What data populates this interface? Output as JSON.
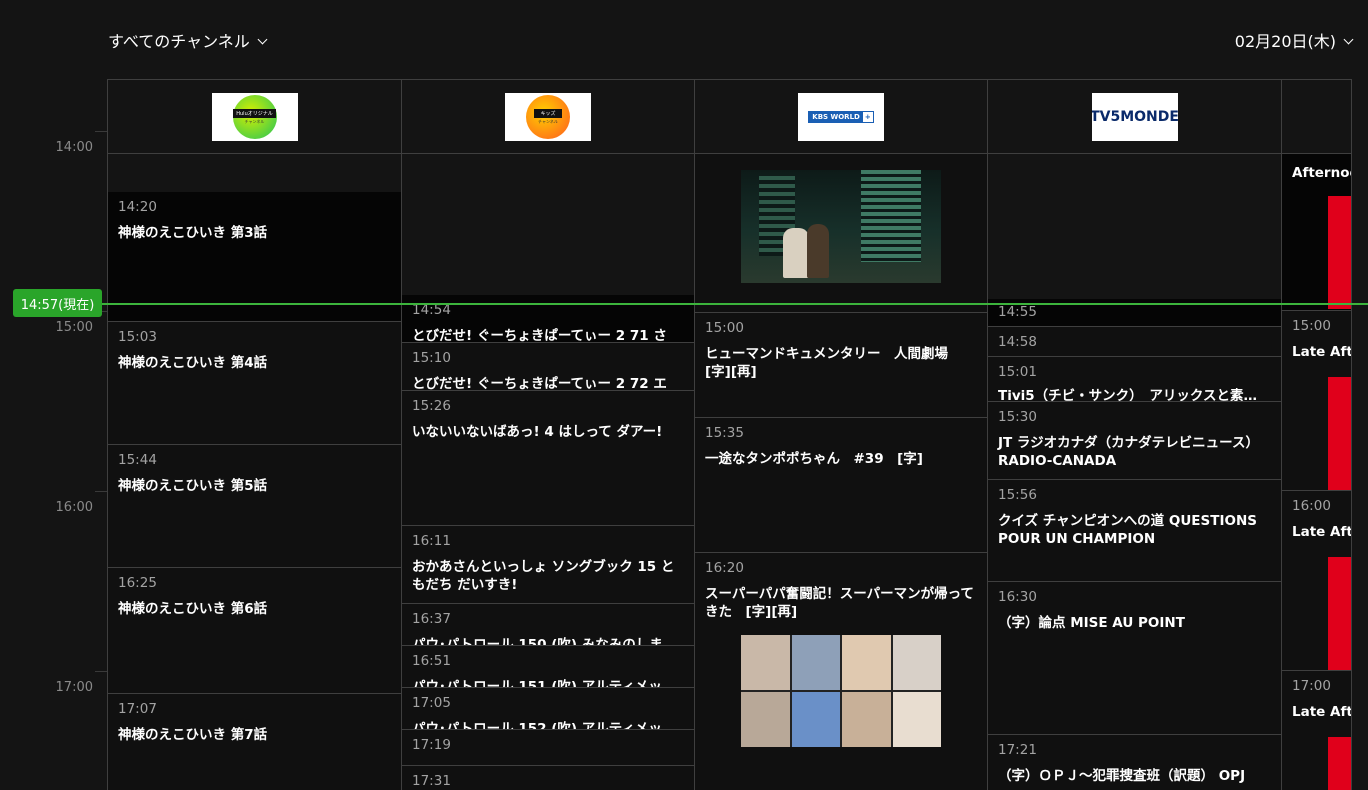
{
  "header": {
    "channel_filter": "すべてのチャンネル",
    "date": "02月20日(木)"
  },
  "current_time_badge": "14:57(現在)",
  "time_labels": [
    "14:00",
    "15:00",
    "16:00",
    "17:00"
  ],
  "channels": [
    {
      "name": "",
      "logo_text": "Huluオリジナル",
      "logo_sub": "チャンネル",
      "programs": [
        {
          "time": "14:20",
          "title": "神様のえこひいき 第3話"
        },
        {
          "time": "15:03",
          "title": "神様のえこひいき 第4話"
        },
        {
          "time": "15:44",
          "title": "神様のえこひいき 第5話"
        },
        {
          "time": "16:25",
          "title": "神様のえこひいき 第6話"
        },
        {
          "time": "17:07",
          "title": "神様のえこひいき 第7話"
        }
      ]
    },
    {
      "name": "",
      "logo_text": "キッズ",
      "logo_sub": "チャンネル",
      "programs": [
        {
          "time": "14:54",
          "title": "とびだせ! ぐーちょきぱーてぃー 2 71 さ"
        },
        {
          "time": "15:10",
          "title": "とびだせ! ぐーちょきぱーてぃー 2 72 エ"
        },
        {
          "time": "15:26",
          "title": "いないいないばあっ! 4 はしって ダアー!"
        },
        {
          "time": "16:11",
          "title": "おかあさんといっしょ ソングブック 15 ともだち だいすき!"
        },
        {
          "time": "16:37",
          "title": "パウ･パトロール 150 (吹) みなみのしま…"
        },
        {
          "time": "16:51",
          "title": "パウ･パトロール 151 (吹) アルティメッ…"
        },
        {
          "time": "17:05",
          "title": "パウ･パトロール 152 (吹) アルティメッ…"
        },
        {
          "time": "17:19",
          "title": ""
        },
        {
          "time": "17:31",
          "title": ""
        }
      ]
    },
    {
      "name": "",
      "logo_text": "KBS WORLD",
      "programs": [
        {
          "time": "15:00",
          "title": "ヒューマンドキュメンタリー　人間劇場 [字][再]"
        },
        {
          "time": "15:35",
          "title": "一途なタンポポちゃん　#39　[字]"
        },
        {
          "time": "16:20",
          "title": "スーパーパパ奮闘記！スーパーマンが帰ってきた　[字][再]"
        }
      ]
    },
    {
      "name": "",
      "logo_text": "TV5MONDE",
      "programs": [
        {
          "time": "14:55",
          "title": ""
        },
        {
          "time": "14:58",
          "title": ""
        },
        {
          "time": "15:01",
          "title": "Tivi5（チビ・サンク）　アリックスと素…"
        },
        {
          "time": "15:30",
          "title": "JT ラジオカナダ（カナダテレビニュース） RADIO-CANADA"
        },
        {
          "time": "15:56",
          "title": "クイズ チャンピオンへの道 QUESTIONS POUR UN CHAMPION"
        },
        {
          "time": "16:30",
          "title": "（字）論点 MISE AU POINT"
        },
        {
          "time": "17:21",
          "title": "（字）ＯＰＪ～犯罪捜査班（訳題） OPJ"
        }
      ]
    },
    {
      "name": "",
      "programs": [
        {
          "time": "",
          "title": "Afternoon"
        },
        {
          "time": "15:00",
          "title": "Late Afternoon"
        },
        {
          "time": "16:00",
          "title": "Late Afternoon"
        },
        {
          "time": "17:00",
          "title": "Late Afternoon"
        }
      ]
    }
  ],
  "colors": {
    "now": "#2aa52a",
    "accent_red": "#e0001b",
    "bg": "#141414"
  }
}
